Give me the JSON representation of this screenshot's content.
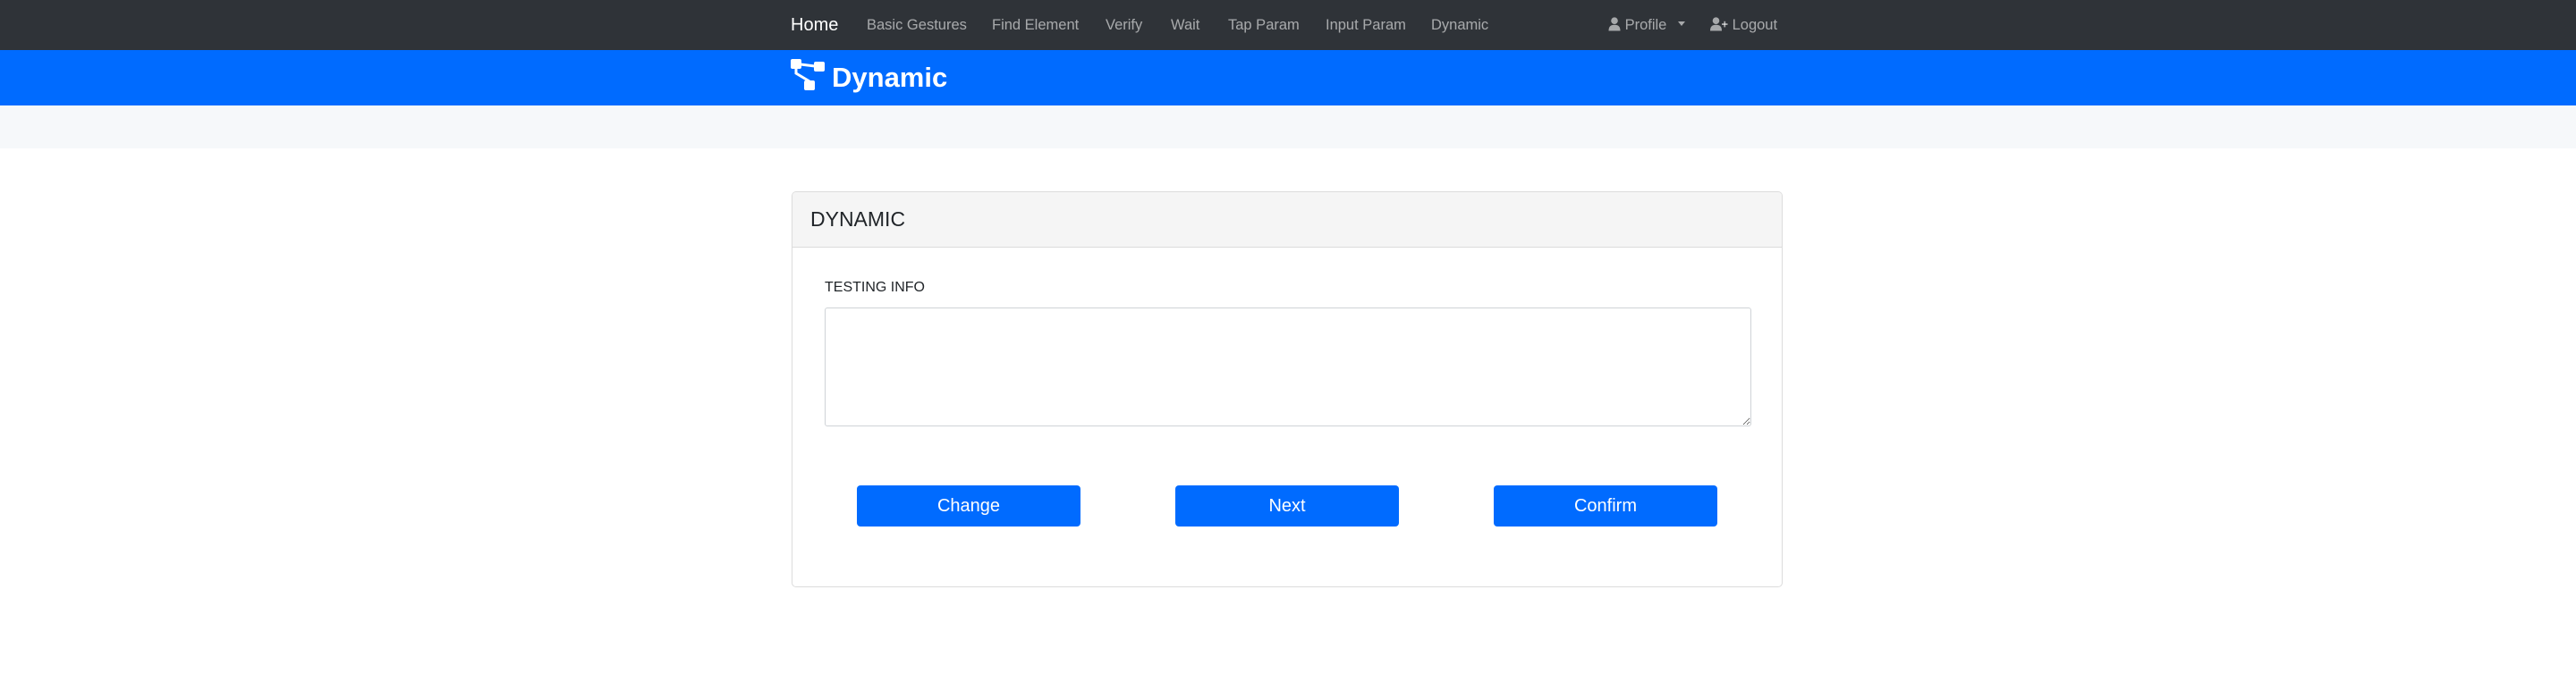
{
  "navbar": {
    "home": "Home",
    "links": [
      "Basic Gestures",
      "Find Element",
      "Verify",
      "Wait",
      "Tap Param",
      "Input Param",
      "Dynamic"
    ],
    "profile": "Profile",
    "logout": "Logout"
  },
  "banner": {
    "title": "Dynamic",
    "icon": "sitemap-icon"
  },
  "card": {
    "title": "DYNAMIC",
    "field_label": "TESTING INFO",
    "textarea_value": "",
    "buttons": {
      "change": "Change",
      "next": "Next",
      "confirm": "Confirm"
    }
  },
  "colors": {
    "navbar_bg": "#2f3338",
    "banner_bg": "#006bff",
    "button_bg": "#006bff",
    "subbar_bg": "#f6f8fa"
  }
}
